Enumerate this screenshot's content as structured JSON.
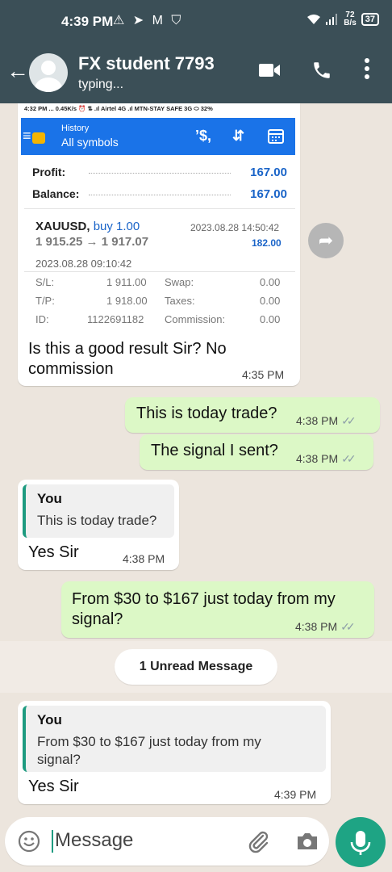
{
  "status_bar": {
    "time": "4:39 PM",
    "icons": "⚠ ➤ M ⛉",
    "net_speed": "72",
    "net_unit": "B/s",
    "battery": "37"
  },
  "header": {
    "back_icon": "←",
    "contact_name": "FX student 7793",
    "status": "typing..."
  },
  "messages": {
    "m1": {
      "screenshot": {
        "phone_status": "4:32 PM ...    0.45K/s ⏰ ⇅ .ıl Airtel 4G .ıl MTN-STAY SAFE 3G ⬭ 32%",
        "history_label": "History",
        "symbols_label": "All symbols",
        "profit_label": "Profit:",
        "profit_value": "167.00",
        "balance_label": "Balance:",
        "balance_value": "167.00",
        "symbol": "XAUUSD,",
        "side": "buy 1.00",
        "prices": "1 915.25 → 1 917.07",
        "close_time": "2023.08.28 14:50:42",
        "trade_profit": "182.00",
        "open_time": "2023.08.28 09:10:42",
        "sl_label": "S/L:",
        "sl_value": "1 911.00",
        "swap_label": "Swap:",
        "swap_value": "0.00",
        "tp_label": "T/P:",
        "tp_value": "1 918.00",
        "taxes_label": "Taxes:",
        "taxes_value": "0.00",
        "id_label": "ID:",
        "id_value": "1122691182",
        "commission_label": "Commission:",
        "commission_value": "0.00"
      },
      "text_line1": "Is this a good result Sir? No",
      "text_line2": "commission",
      "time": "4:35 PM"
    },
    "m2": {
      "text": "This is today trade?",
      "time": "4:38 PM"
    },
    "m3": {
      "text": "The signal I sent?",
      "time": "4:38 PM"
    },
    "m4": {
      "quote_name": "You",
      "quote_text": "This is today trade?",
      "text": "Yes Sir",
      "time": "4:38 PM"
    },
    "m5": {
      "text_line1": "From $30 to $167 just today from my",
      "text_line2": "signal?",
      "time": "4:38 PM"
    },
    "unread": "1 Unread Message",
    "m6": {
      "quote_name": "You",
      "quote_line1": "From $30 to $167 just today from my",
      "quote_line2": "signal?",
      "text": "Yes Sir",
      "time": "4:39 PM"
    }
  },
  "composer": {
    "placeholder": "Message"
  },
  "colors": {
    "header": "#3b4f57",
    "outgoing": "#dcf8c6",
    "incoming": "#ffffff",
    "accent": "#1ea484",
    "mt_blue": "#1a73e8"
  }
}
